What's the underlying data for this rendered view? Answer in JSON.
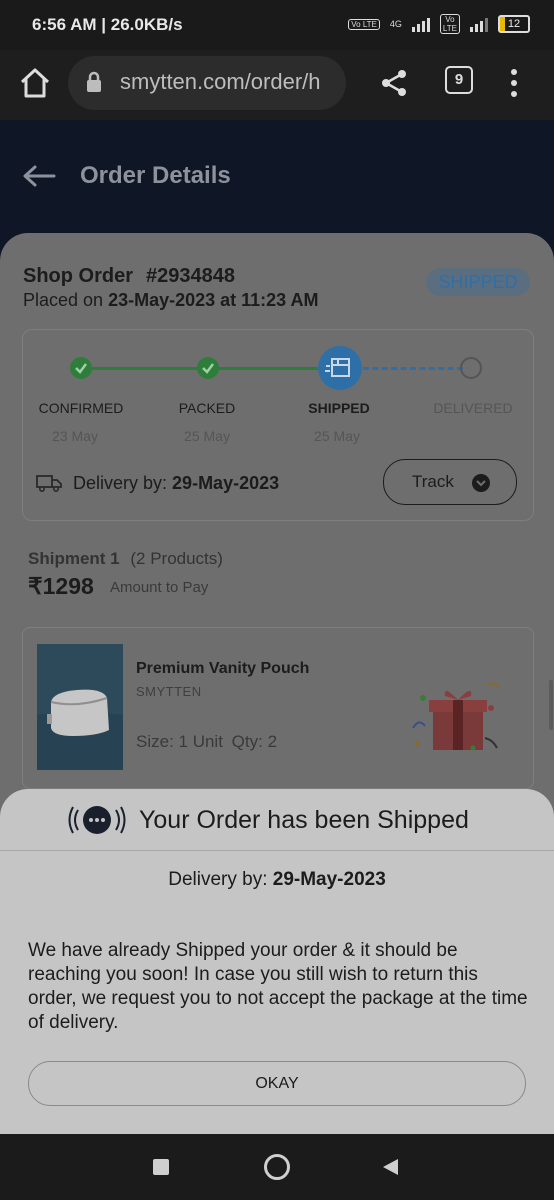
{
  "status_bar": {
    "time": "6:56 AM",
    "net_speed": "26.0KB/s",
    "network_4g": "4G",
    "volte_label": "Vo LTE",
    "battery": "12"
  },
  "browser": {
    "url": "smytten.com/order/h",
    "tab_count": "9"
  },
  "header": {
    "title": "Order Details"
  },
  "order": {
    "label": "Shop Order",
    "number": "#2934848",
    "placed_prefix": "Placed on",
    "placed_date": "23-May-2023 at 11:23 AM",
    "status_badge": "SHIPPED"
  },
  "progress": {
    "steps": [
      {
        "label": "CONFIRMED",
        "date": "23 May"
      },
      {
        "label": "PACKED",
        "date": "25 May"
      },
      {
        "label": "SHIPPED",
        "date": "25 May"
      },
      {
        "label": "DELIVERED",
        "date": ""
      }
    ],
    "delivery_prefix": "Delivery by:",
    "delivery_date": "29-May-2023",
    "track_label": "Track"
  },
  "shipment": {
    "title": "Shipment 1",
    "products_count": "(2 Products)",
    "amount": "₹1298",
    "amount_label": "Amount to Pay"
  },
  "product": {
    "name": "Premium Vanity Pouch",
    "brand": "SMYTTEN",
    "size": "Size: 1 Unit",
    "qty": "Qty: 2"
  },
  "sheet": {
    "title": "Your Order has been Shipped",
    "delivery_prefix": "Delivery by:",
    "delivery_date": "29-May-2023",
    "message": "We have already Shipped your order & it should be reaching you soon! In case you still wish to return this order, we request you to not accept the package at the time of delivery.",
    "ok_label": "OKAY"
  },
  "colors": {
    "header_bg": "#0f1626",
    "step_done": "#2f7d3a",
    "step_active": "#2f6fa8",
    "sheet_bg": "#c5c5c5"
  }
}
